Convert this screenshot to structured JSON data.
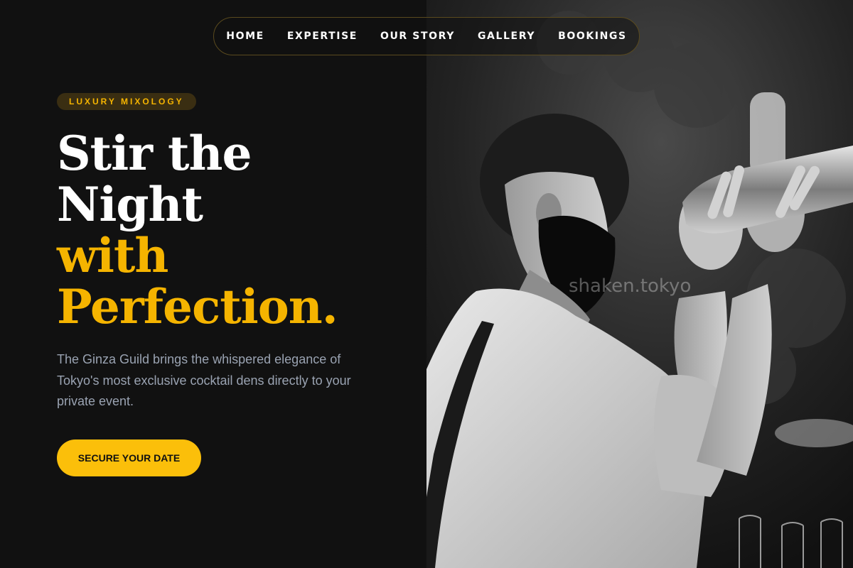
{
  "nav": {
    "items": [
      {
        "label": "HOME"
      },
      {
        "label": "EXPERTISE"
      },
      {
        "label": "OUR STORY"
      },
      {
        "label": "GALLERY"
      },
      {
        "label": "BOOKINGS"
      }
    ]
  },
  "hero": {
    "badge": "LUXURY MIXOLOGY",
    "headline_line1": "Stir the",
    "headline_line2": "Night",
    "headline_line3": "with",
    "headline_line4": "Perfection.",
    "description": "The Ginza Guild brings the whispered elegance of Tokyo's most exclusive cocktail dens directly to your private event.",
    "cta_label": "SECURE YOUR DATE"
  },
  "photo": {
    "watermark": "shaken.tokyo"
  },
  "colors": {
    "background": "#111111",
    "accent": "#f5b400",
    "button": "#fbbf0a",
    "body_text": "#9aa3b2"
  }
}
